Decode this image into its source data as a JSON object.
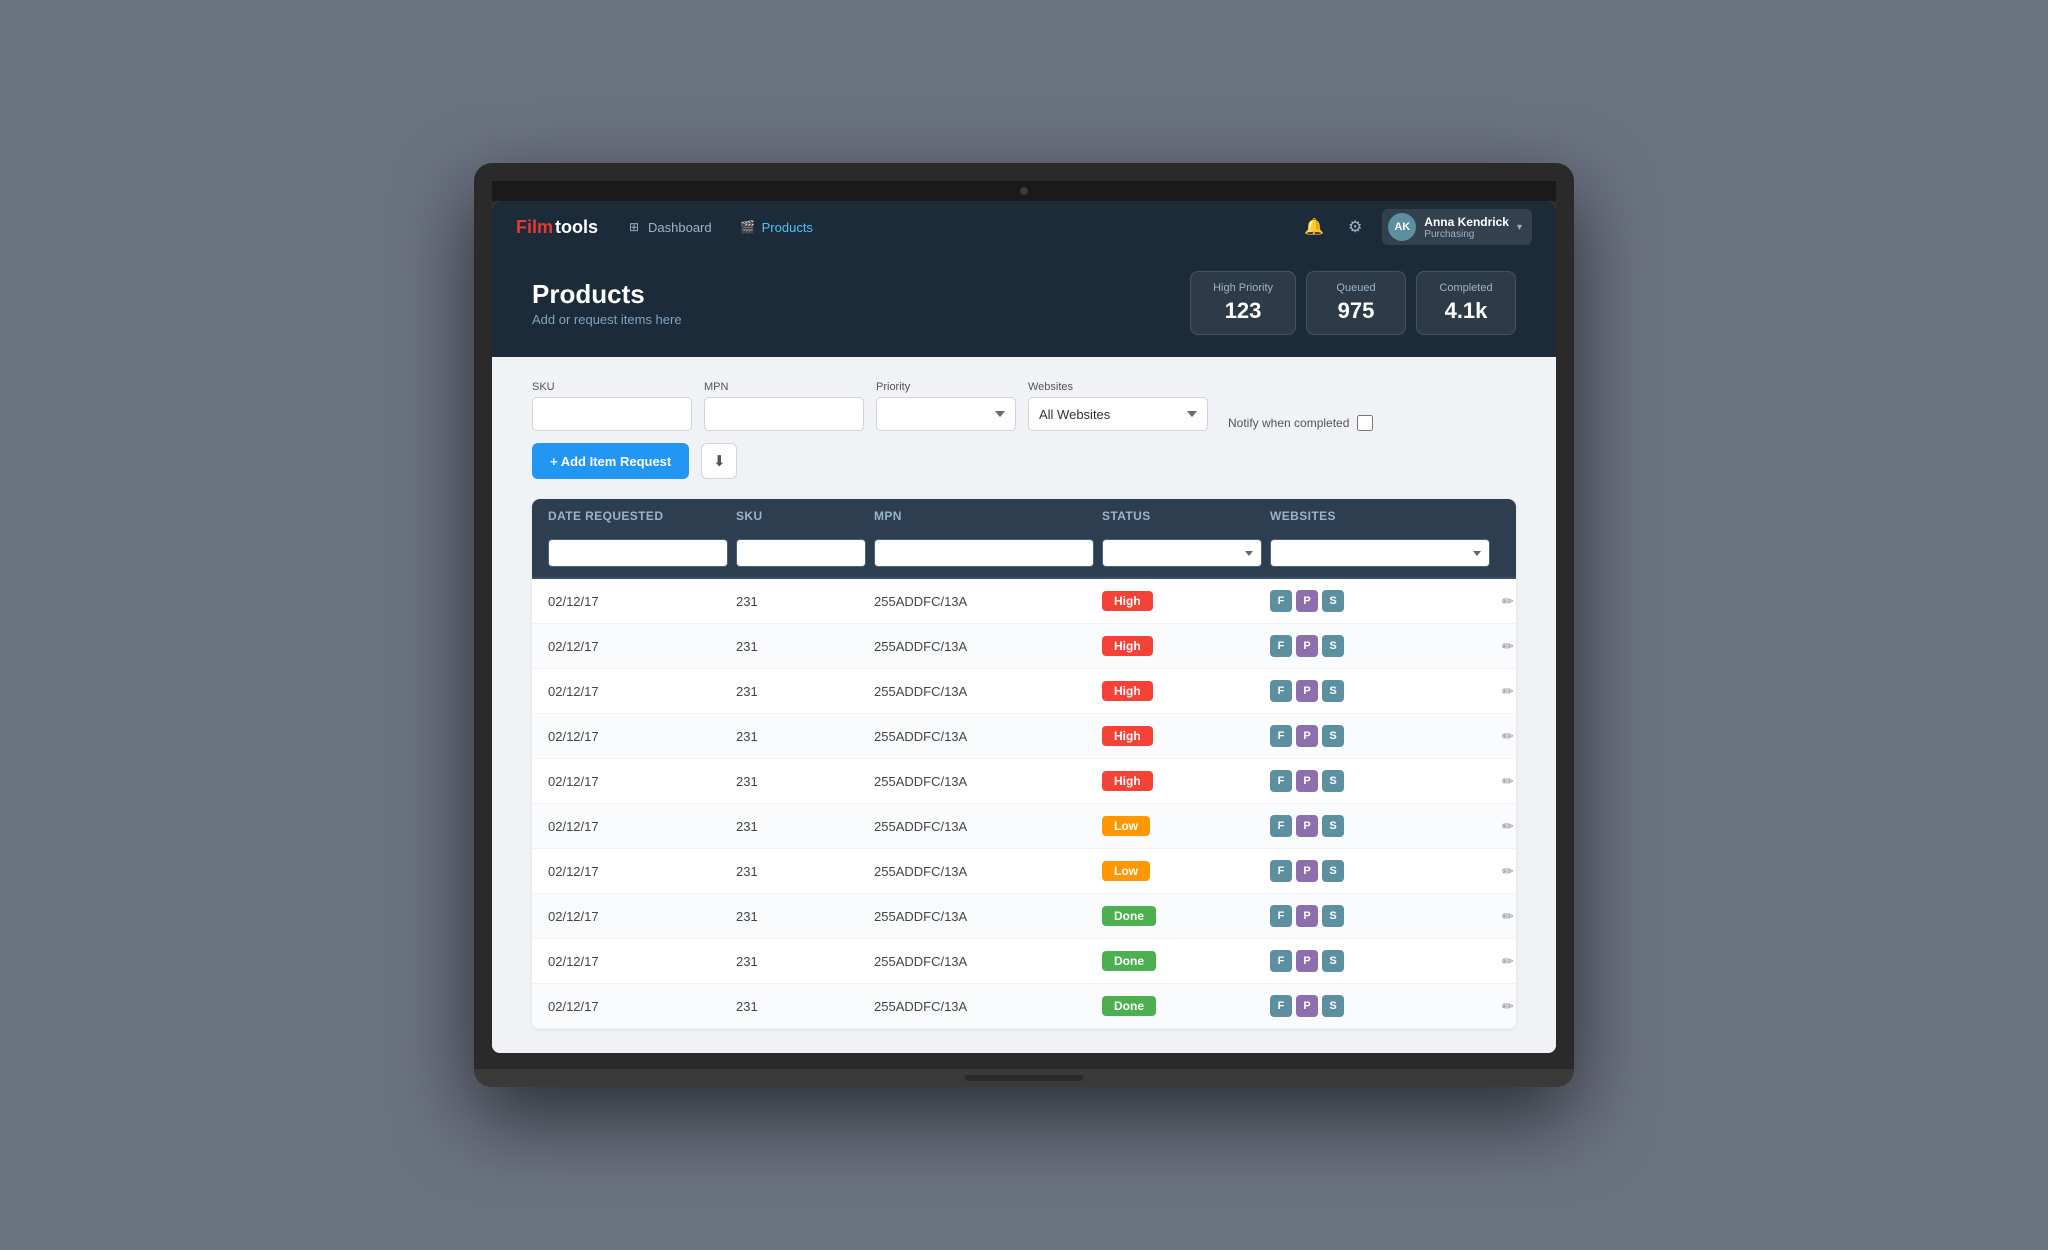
{
  "app": {
    "logo_film": "Film",
    "logo_tools": "tools"
  },
  "navbar": {
    "dashboard_label": "Dashboard",
    "products_label": "Products"
  },
  "user": {
    "name": "Anna Kendrick",
    "role": "Purchasing",
    "initials": "AK"
  },
  "page": {
    "title": "Products",
    "subtitle": "Add or request items here"
  },
  "stats": [
    {
      "label": "High Priority",
      "value": "123"
    },
    {
      "label": "Queued",
      "value": "975"
    },
    {
      "label": "Completed",
      "value": "4.1k"
    }
  ],
  "filters": {
    "sku_label": "SKU",
    "mpn_label": "MPN",
    "priority_label": "Priority",
    "websites_label": "Websites",
    "websites_default": "All Websites",
    "notify_label": "Notify when completed",
    "add_btn_label": "+ Add Item Request"
  },
  "table": {
    "columns": [
      "Date requested",
      "SKU",
      "MPN",
      "Status",
      "Websites",
      ""
    ],
    "rows": [
      {
        "date": "02/12/17",
        "sku": "231",
        "mpn": "255ADDFC/13A",
        "status": "High",
        "status_type": "high"
      },
      {
        "date": "02/12/17",
        "sku": "231",
        "mpn": "255ADDFC/13A",
        "status": "High",
        "status_type": "high"
      },
      {
        "date": "02/12/17",
        "sku": "231",
        "mpn": "255ADDFC/13A",
        "status": "High",
        "status_type": "high"
      },
      {
        "date": "02/12/17",
        "sku": "231",
        "mpn": "255ADDFC/13A",
        "status": "High",
        "status_type": "high"
      },
      {
        "date": "02/12/17",
        "sku": "231",
        "mpn": "255ADDFC/13A",
        "status": "High",
        "status_type": "high"
      },
      {
        "date": "02/12/17",
        "sku": "231",
        "mpn": "255ADDFC/13A",
        "status": "Low",
        "status_type": "low"
      },
      {
        "date": "02/12/17",
        "sku": "231",
        "mpn": "255ADDFC/13A",
        "status": "Low",
        "status_type": "low"
      },
      {
        "date": "02/12/17",
        "sku": "231",
        "mpn": "255ADDFC/13A",
        "status": "Done",
        "status_type": "done"
      },
      {
        "date": "02/12/17",
        "sku": "231",
        "mpn": "255ADDFC/13A",
        "status": "Done",
        "status_type": "done"
      },
      {
        "date": "02/12/17",
        "sku": "231",
        "mpn": "255ADDFC/13A",
        "status": "Done",
        "status_type": "done"
      }
    ],
    "website_badges": [
      "F",
      "P",
      "S"
    ]
  }
}
